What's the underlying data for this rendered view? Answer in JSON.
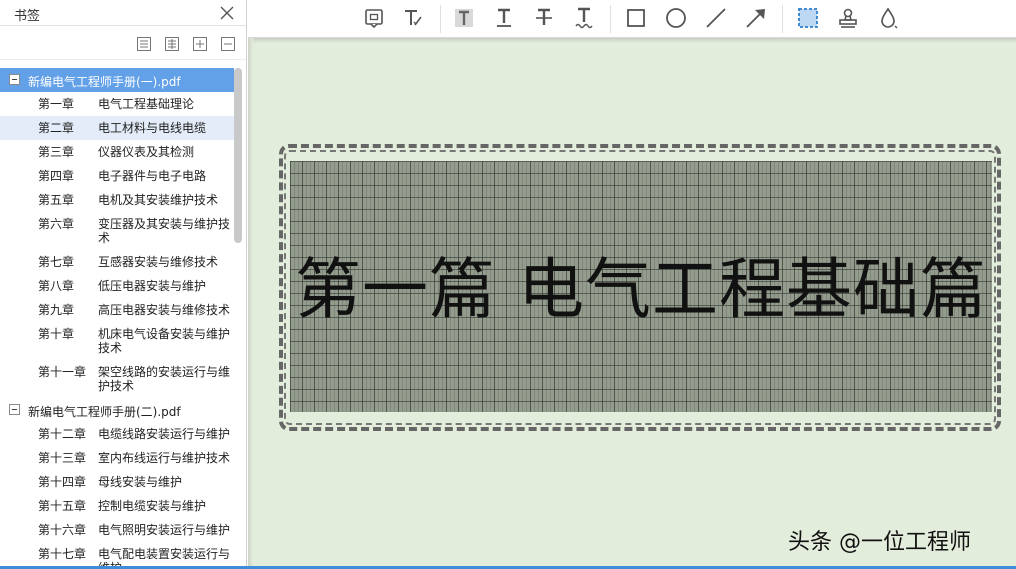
{
  "sidebar": {
    "title": "书签",
    "documents": [
      {
        "name": "新编电气工程师手册(一).pdf",
        "chapters": [
          {
            "num": "第一章",
            "title": "电气工程基础理论"
          },
          {
            "num": "第二章",
            "title": "电工材料与电线电缆"
          },
          {
            "num": "第三章",
            "title": "仪器仪表及其检测"
          },
          {
            "num": "第四章",
            "title": "电子器件与电子电路"
          },
          {
            "num": "第五章",
            "title": "电机及其安装维护技术"
          },
          {
            "num": "第六章",
            "title": "变压器及其安装与维护技术"
          },
          {
            "num": "第七章",
            "title": "互感器安装与维修技术"
          },
          {
            "num": "第八章",
            "title": "低压电器安装与维护"
          },
          {
            "num": "第九章",
            "title": "高压电器安装与维修技术"
          },
          {
            "num": "第十章",
            "title": "机床电气设备安装与维护技术"
          },
          {
            "num": "第十一章",
            "title": "架空线路的安装运行与维护技术"
          }
        ]
      },
      {
        "name": "新编电气工程师手册(二).pdf",
        "chapters": [
          {
            "num": "第十二章",
            "title": "电缆线路安装运行与维护"
          },
          {
            "num": "第十三章",
            "title": "室内布线运行与维护技术"
          },
          {
            "num": "第十四章",
            "title": "母线安装与维护"
          },
          {
            "num": "第十五章",
            "title": "控制电缆安装与维护"
          },
          {
            "num": "第十六章",
            "title": "电气照明安装运行与维护"
          },
          {
            "num": "第十七章",
            "title": "电气配电装置安装运行与维护"
          }
        ]
      }
    ]
  },
  "toolbar": {
    "tools": [
      "note-icon",
      "typewriter-icon",
      "highlight-text-icon",
      "underline-text-icon",
      "strikeout-text-icon",
      "squiggly-text-icon",
      "rectangle-icon",
      "ellipse-icon",
      "line-icon",
      "arrow-icon",
      "area-select-icon",
      "stamp-icon",
      "color-drop-icon"
    ]
  },
  "document": {
    "heading": "第一篇  电气工程基础篇",
    "watermark": "头条 @一位工程师"
  },
  "colors": {
    "selection": "#62a0e8",
    "page_background": "#e3eddb",
    "grid": "#949c8d",
    "accent": "#3c8fd8"
  }
}
